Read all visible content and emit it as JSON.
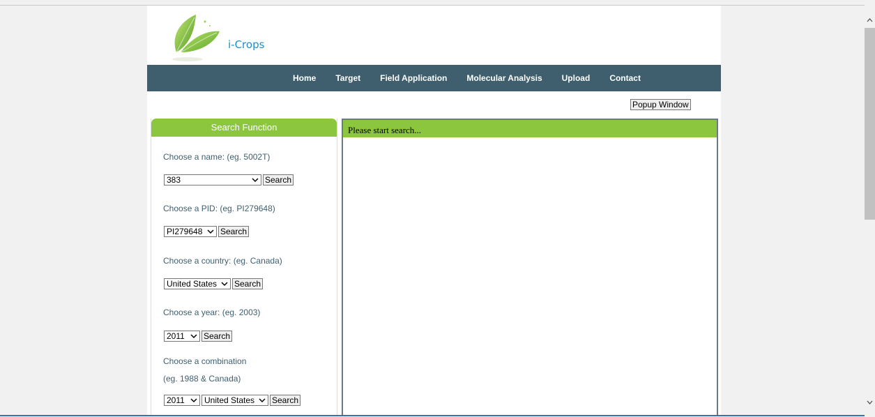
{
  "header": {
    "logo_text": "i-Crops"
  },
  "nav": {
    "items": [
      "Home",
      "Target",
      "Field Application",
      "Molecular Analysis",
      "Upload",
      "Contact"
    ]
  },
  "popup_button": "Popup Window",
  "sidebar": {
    "title": "Search Function",
    "name_label": "Choose a name: (eg. 5002T)",
    "name_value": "383",
    "pid_label": "Choose a PID: (eg. PI279648)",
    "pid_value": "PI279648",
    "country_label": "Choose a country: (eg. Canada)",
    "country_value": "United States",
    "year_label": "Choose a year: (eg. 2003)",
    "year_value": "2011",
    "combo_label": "Choose a combination",
    "combo_example": "(eg. 1988 & Canada)",
    "combo_year_value": "2011",
    "combo_country_value": "United States",
    "search_label": "Search"
  },
  "results": {
    "header": "Please start search..."
  },
  "colors": {
    "accent_green": "#8cc63f",
    "navbar": "#3f5f6f",
    "logo_blue": "#1c8fc9"
  }
}
